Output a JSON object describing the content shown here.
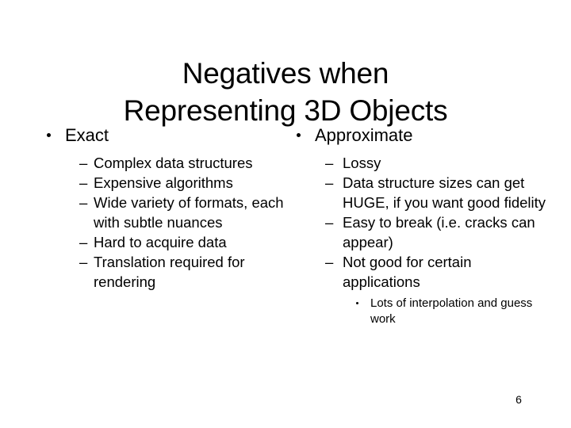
{
  "slide": {
    "title_lines": [
      "Negatives when",
      "Representing 3D Objects"
    ],
    "page_number": "6",
    "bullet_glyph_level1": "•",
    "bullet_glyph_level2": "–",
    "bullet_glyph_level3": "•",
    "text_color": "#000000",
    "background_color": "#ffffff"
  },
  "columns": {
    "left": {
      "heading": "Exact",
      "items": [
        "Complex data structures",
        "Expensive algorithms",
        "Wide variety of formats, each with subtle nuances",
        "Hard to acquire data",
        "Translation required for rendering"
      ]
    },
    "right": {
      "heading": "Approximate",
      "items": [
        "Lossy",
        "Data structure sizes can get HUGE, if you want good fidelity",
        "Easy to break (i.e. cracks can appear)",
        "Not good for certain applications"
      ],
      "subitems": [
        "Lots of interpolation and guess work"
      ]
    }
  }
}
